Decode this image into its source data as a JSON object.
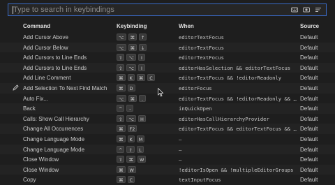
{
  "search": {
    "placeholder": "Type to search in keybindings",
    "value": "",
    "icons": [
      "keyboard-icon",
      "record-keys-icon",
      "sort-by-precedence-icon"
    ]
  },
  "columns": {
    "command": "Command",
    "keybinding": "Keybinding",
    "when": "When",
    "source": "Source"
  },
  "rows": [
    {
      "command": "Add Cursor Above",
      "keys": [
        "⌥",
        "⌘",
        "↑"
      ],
      "when": "editorTextFocus",
      "source": "Default"
    },
    {
      "command": "Add Cursor Below",
      "keys": [
        "⌥",
        "⌘",
        "↓"
      ],
      "when": "editorTextFocus",
      "source": "Default"
    },
    {
      "command": "Add Cursors to Line Ends",
      "keys": [
        "⇧",
        "⌥",
        "I"
      ],
      "when": "editorTextFocus",
      "source": "Default"
    },
    {
      "command": "Add Cursors to Line Ends",
      "keys": [
        "⇧",
        "⌥",
        "I"
      ],
      "when": "editorHasSelection && editorTextFocus",
      "source": "Default"
    },
    {
      "command": "Add Line Comment",
      "keys": [
        "⌘",
        "K",
        "⌘",
        "C"
      ],
      "when": "editorTextFocus && !editorReadonly",
      "source": "Default"
    },
    {
      "command": "Add Selection To Next Find Match",
      "keys": [
        "⌘",
        "D"
      ],
      "when": "editorFocus",
      "source": "Default",
      "editing": true
    },
    {
      "command": "Auto Fix...",
      "keys": [
        "⌥",
        "⌘",
        "."
      ],
      "when": "editorTextFocus && !editorReadonly && su...",
      "source": "Default"
    },
    {
      "command": "Back",
      "keys": [
        "^",
        "-"
      ],
      "when": "inQuickOpen",
      "source": "Default"
    },
    {
      "command": "Calls: Show Call Hierarchy",
      "keys": [
        "⇧",
        "⌥",
        "H"
      ],
      "when": "editorHasCallHierarchyProvider",
      "source": "Default"
    },
    {
      "command": "Change All Occurrences",
      "keys": [
        "⌘",
        "F2"
      ],
      "when": "editorTextFocus && editorTextFocus && !e...",
      "source": "Default"
    },
    {
      "command": "Change Language Mode",
      "keys": [
        "⌘",
        "K",
        "M"
      ],
      "when": "—",
      "source": "Default"
    },
    {
      "command": "Change Language Mode",
      "keys": [
        "^",
        "⇧",
        "L"
      ],
      "when": "—",
      "source": "Default"
    },
    {
      "command": "Close Window",
      "keys": [
        "⇧",
        "⌘",
        "W"
      ],
      "when": "—",
      "source": "Default"
    },
    {
      "command": "Close Window",
      "keys": [
        "⌘",
        "W"
      ],
      "when": "!editorIsOpen && !multipleEditorGroups",
      "source": "Default"
    },
    {
      "command": "Copy",
      "keys": [
        "⌘",
        "C"
      ],
      "when": "textInputFocus",
      "source": "Default"
    }
  ]
}
